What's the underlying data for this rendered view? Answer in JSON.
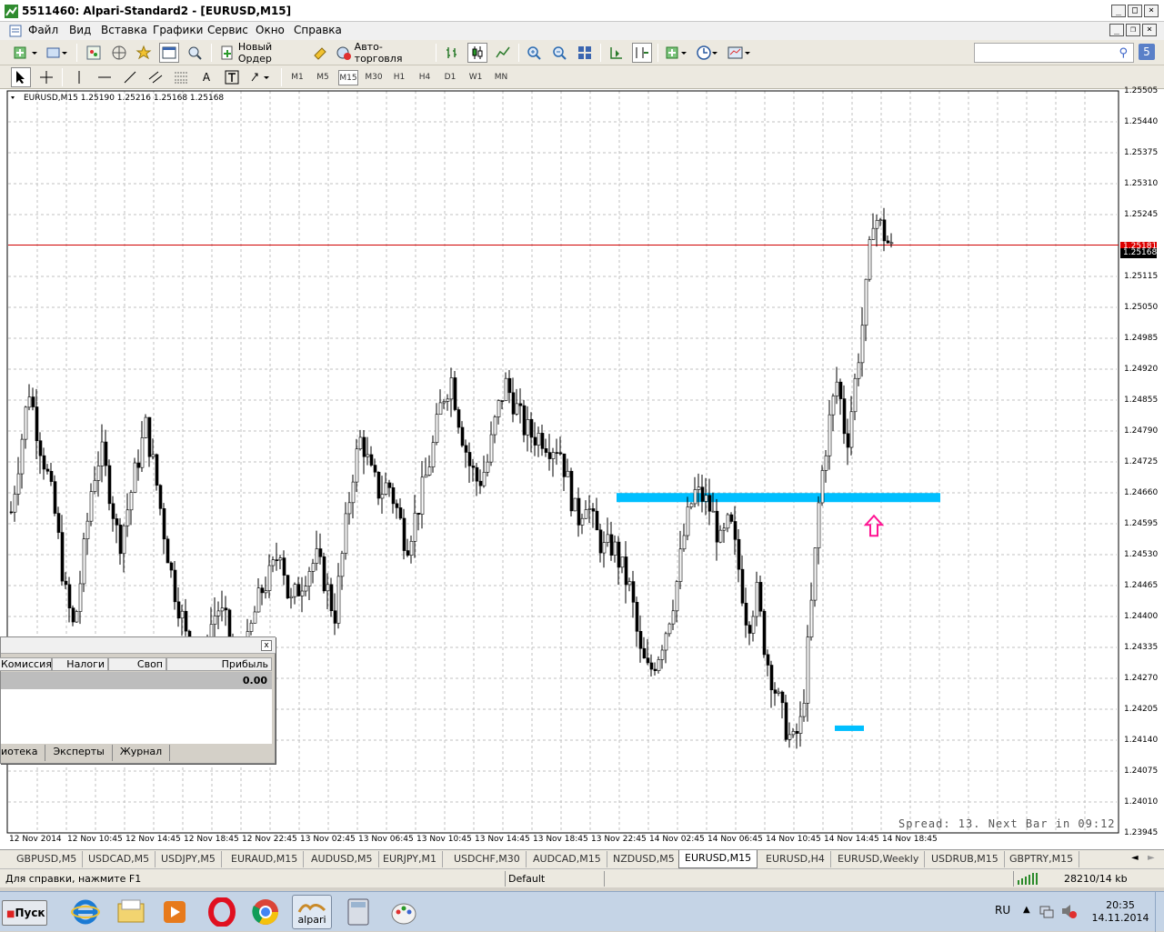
{
  "window": {
    "title": "5511460: Alpari-Standard2 - [EURUSD,M15]"
  },
  "menu": [
    "Файл",
    "Вид",
    "Вставка",
    "Графики",
    "Сервис",
    "Окно",
    "Справка"
  ],
  "toolbar": {
    "new_order": "Новый Ордер",
    "auto_trading": "Авто-торговля"
  },
  "timeframes": [
    "M1",
    "M5",
    "M15",
    "M30",
    "H1",
    "H4",
    "D1",
    "W1",
    "MN"
  ],
  "active_timeframe": "M15",
  "chart": {
    "symbol_info": "EURUSD,M15  1.25190 1.25216 1.25168 1.25168",
    "spread_info": "Spread: 13. Next Bar in 09:12",
    "ask_price": "1.25181",
    "bid_price": "1.25168",
    "y_labels": [
      "1.25505",
      "1.25440",
      "1.25375",
      "1.25310",
      "1.25245",
      "1.25115",
      "1.25050",
      "1.24985",
      "1.24920",
      "1.24855",
      "1.24790",
      "1.24725",
      "1.24660",
      "1.24595",
      "1.24530",
      "1.24465",
      "1.24400",
      "1.24335",
      "1.24270",
      "1.24205",
      "1.24140",
      "1.24075",
      "1.24010",
      "1.23945"
    ],
    "x_labels": [
      "12 Nov 2014",
      "12 Nov 10:45",
      "12 Nov 14:45",
      "12 Nov 18:45",
      "12 Nov 22:45",
      "13 Nov 02:45",
      "13 Nov 06:45",
      "13 Nov 10:45",
      "13 Nov 14:45",
      "13 Nov 18:45",
      "13 Nov 22:45",
      "14 Nov 02:45",
      "14 Nov 06:45",
      "14 Nov 10:45",
      "14 Nov 14:45",
      "14 Nov 18:45"
    ],
    "colors": {
      "bull": "#ffffff",
      "bear": "#000000",
      "grid": "#c0c0c0",
      "ask_line": "#d00000",
      "zone": "#00bfff",
      "arrow": "#ff1493"
    }
  },
  "chart_data": {
    "type": "candlestick",
    "symbol": "EURUSD",
    "timeframe": "M15",
    "ylim": [
      1.23945,
      1.25505
    ],
    "last": {
      "open": 1.2519,
      "high": 1.25216,
      "low": 1.25168,
      "close": 1.25168
    },
    "ask": 1.25181,
    "bid": 1.25168,
    "support_zone_price": 1.2465,
    "lower_zone_price": 1.24165,
    "close_path": [
      1.2462,
      1.2475,
      1.2488,
      1.2478,
      1.247,
      1.246,
      1.2445,
      1.2437,
      1.2452,
      1.2468,
      1.2475,
      1.2466,
      1.2455,
      1.2463,
      1.2472,
      1.248,
      1.247,
      1.2458,
      1.2447,
      1.244,
      1.243,
      1.2421,
      1.2437,
      1.2442,
      1.2438,
      1.2425,
      1.2431,
      1.244,
      1.2446,
      1.2449,
      1.2455,
      1.2442,
      1.2446,
      1.245,
      1.2452,
      1.2447,
      1.244,
      1.2455,
      1.247,
      1.2478,
      1.247,
      1.2466,
      1.2468,
      1.2462,
      1.2455,
      1.2461,
      1.2468,
      1.2476,
      1.2486,
      1.249,
      1.248,
      1.2472,
      1.2468,
      1.2472,
      1.2482,
      1.2489,
      1.2485,
      1.248,
      1.2478,
      1.2478,
      1.2476,
      1.2476,
      1.2468,
      1.246,
      1.2465,
      1.2458,
      1.2454,
      1.2455,
      1.245,
      1.2445,
      1.2432,
      1.2428,
      1.2432,
      1.2438,
      1.2446,
      1.2458,
      1.2466,
      1.2465,
      1.2462,
      1.2455,
      1.246,
      1.245,
      1.2438,
      1.2445,
      1.2432,
      1.2425,
      1.2418,
      1.2413,
      1.2418,
      1.244,
      1.2466,
      1.248,
      1.249,
      1.2476,
      1.249,
      1.2505,
      1.2525,
      1.2521,
      1.2517
    ]
  },
  "terminal": {
    "columns": [
      "Комиссия",
      "Налоги",
      "Своп",
      "Прибыль"
    ],
    "profit": "0.00",
    "tabs": [
      "иотека",
      "Эксперты",
      "Журнал"
    ],
    "close_label": "x"
  },
  "symbol_tabs": [
    "GBPUSD,M5",
    "USDCAD,M5",
    "USDJPY,M5",
    "EURAUD,M15",
    "AUDUSD,M5",
    "EURJPY,M1",
    "USDCHF,M30",
    "AUDCAD,M15",
    "NZDUSD,M5",
    "EURUSD,M15",
    "EURUSD,H4",
    "EURUSD,Weekly",
    "USDRUB,M15",
    "GBPTRY,M15"
  ],
  "active_symbol_tab": "EURUSD,M15",
  "status": {
    "help": "Для справки, нажмите F1",
    "profile": "Default",
    "traffic": "28210/14 kb"
  },
  "taskbar": {
    "start": "Пуск",
    "lang": "RU",
    "time": "20:35",
    "date": "14.11.2014",
    "alpari_label": "alpari"
  }
}
